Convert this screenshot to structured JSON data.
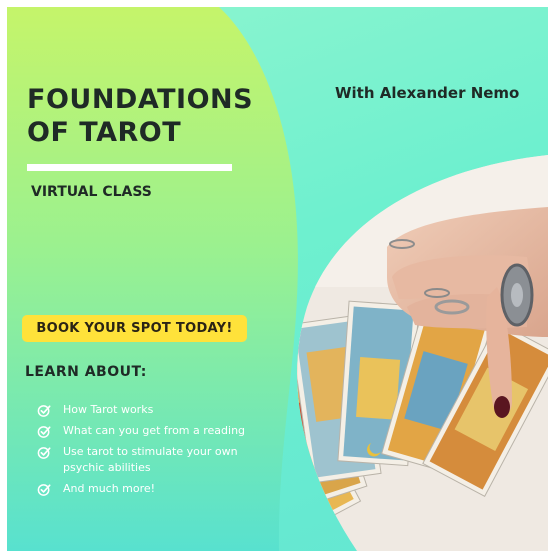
{
  "title_lines": [
    "FOUNDATIONS",
    "OF TAROT"
  ],
  "subtitle": "VIRTUAL CLASS",
  "host": "With Alexander Nemo",
  "cta": "BOOK YOUR SPOT TODAY!",
  "learn_heading": "LEARN ABOUT:",
  "learn_items": [
    "How Tarot works",
    "What can you get from a reading",
    "Use tarot to stimulate your own psychic abilities",
    "And much more!"
  ],
  "colors": {
    "text_dark": "#1f2a26",
    "cta_yellow": "#ffe23a",
    "green_left": "#b6f06e",
    "teal_right": "#6ef0cf"
  },
  "icons": {
    "list_bullet": "check-circle-icon"
  }
}
